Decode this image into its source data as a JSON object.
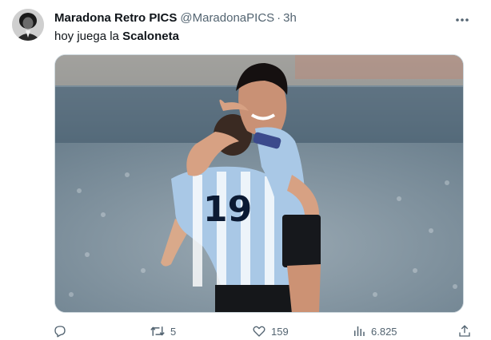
{
  "tweet": {
    "display_name": "Maradona Retro PICS",
    "handle": "@MaradonaPICS",
    "separator": "·",
    "time": "3h",
    "text_prefix": "hoy juega la ",
    "text_bold": "Scaloneta",
    "more_icon": "more-horizontal-icon",
    "media": {
      "shirt_number": "19"
    }
  },
  "actions": {
    "reply": {
      "icon": "reply-icon",
      "count": ""
    },
    "retweet": {
      "icon": "retweet-icon",
      "count": "5"
    },
    "like": {
      "icon": "heart-icon",
      "count": "159"
    },
    "views": {
      "icon": "views-chart-icon",
      "count": "6.825"
    },
    "share": {
      "icon": "share-icon",
      "count": ""
    }
  },
  "colors": {
    "text_primary": "#0f1419",
    "text_secondary": "#536471",
    "border": "#cfd9de",
    "argentina_sky_blue": "#a9c8e6"
  }
}
